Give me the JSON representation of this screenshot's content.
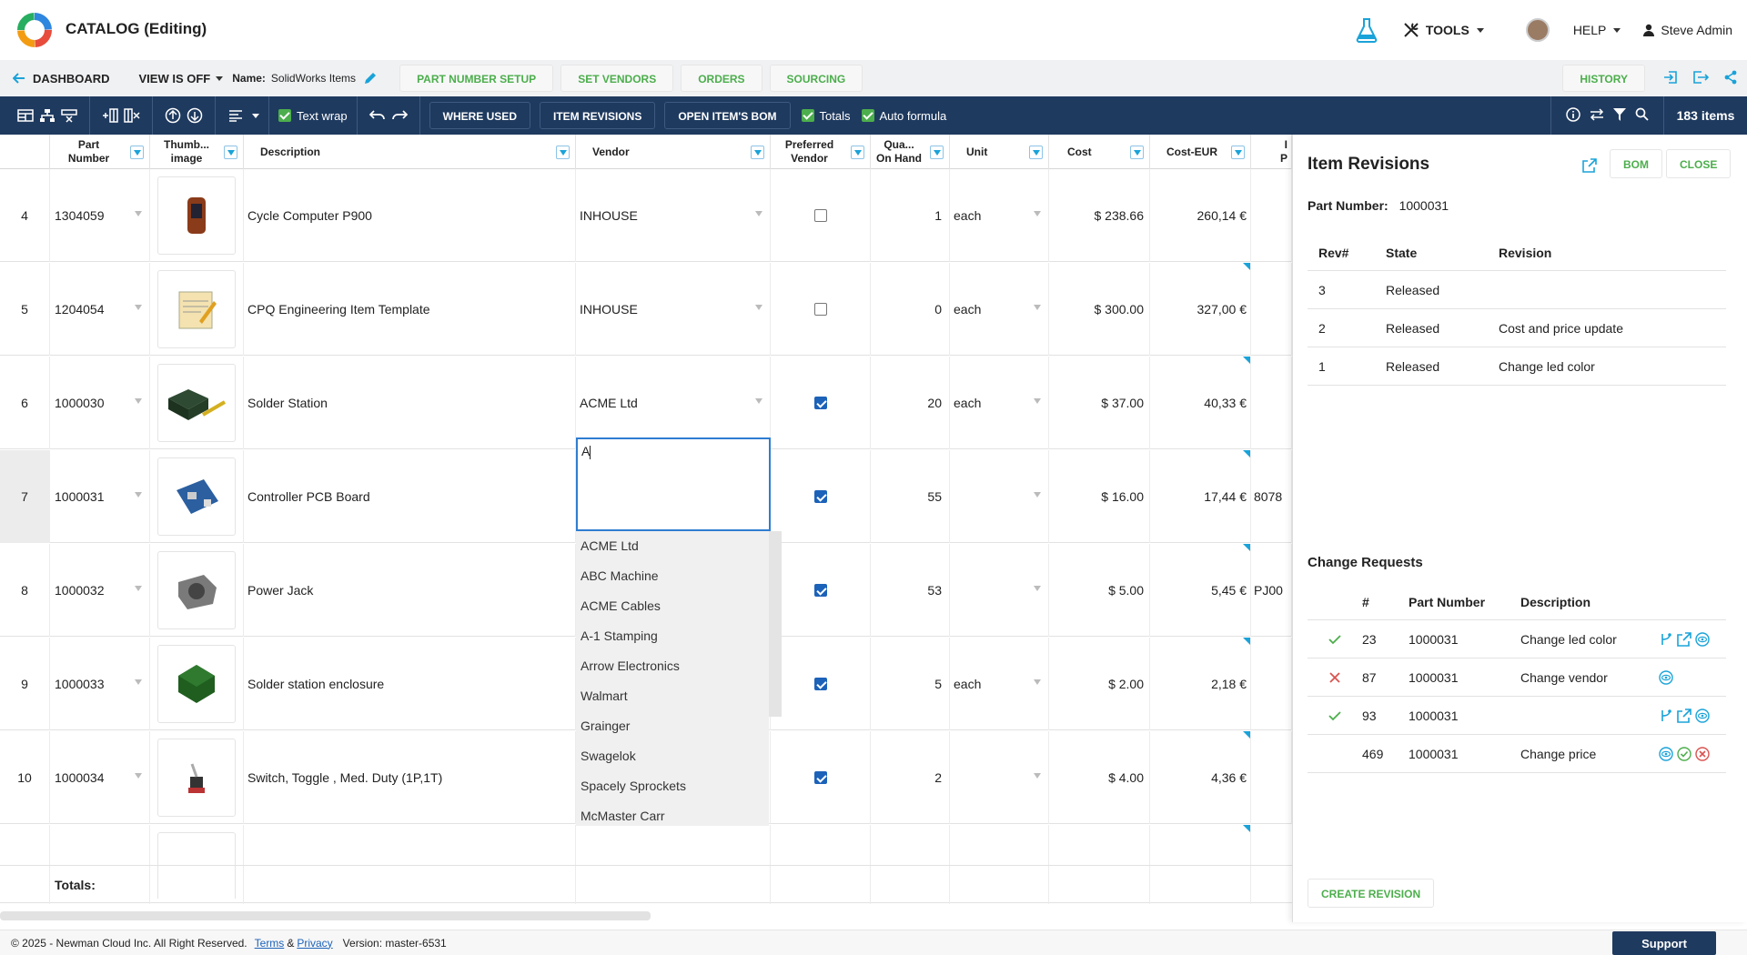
{
  "header": {
    "app_title": "CATALOG (Editing)",
    "tools_label": "TOOLS",
    "help_label": "HELP",
    "user_name": "Steve Admin"
  },
  "subnav": {
    "back_label": "DASHBOARD",
    "view_label": "VIEW IS OFF",
    "name_label": "Name:",
    "name_value": "SolidWorks Items",
    "tabs": [
      "PART NUMBER SETUP",
      "SET VENDORS",
      "ORDERS",
      "SOURCING"
    ],
    "history_label": "HISTORY"
  },
  "toolbar": {
    "text_wrap_label": "Text wrap",
    "text_wrap_checked": true,
    "where_used_label": "WHERE USED",
    "item_revisions_label": "ITEM REVISIONS",
    "open_bom_label": "OPEN ITEM'S BOM",
    "totals_label": "Totals",
    "totals_checked": true,
    "auto_formula_label": "Auto formula",
    "auto_formula_checked": true,
    "item_count": "183 items"
  },
  "grid": {
    "columns": [
      "Part\nNumber",
      "Thumb...\nimage",
      "Description",
      "Vendor",
      "Preferred\nVendor",
      "Qua...\nOn Hand",
      "Unit",
      "Cost",
      "Cost-EUR",
      "I\nP"
    ],
    "rows": [
      {
        "num": "4",
        "part": "1304059",
        "desc": "Cycle Computer P900",
        "vendor": "INHOUSE",
        "pref": false,
        "qty": "1",
        "unit": "each",
        "cost": "$ 238.66",
        "eur": "260,14 €",
        "extra": ""
      },
      {
        "num": "5",
        "part": "1204054",
        "desc": "CPQ Engineering Item Template",
        "vendor": "INHOUSE",
        "pref": false,
        "qty": "0",
        "unit": "each",
        "cost": "$ 300.00",
        "eur": "327,00 €",
        "extra": ""
      },
      {
        "num": "6",
        "part": "1000030",
        "desc": "Solder Station",
        "vendor": "ACME Ltd",
        "pref": true,
        "qty": "20",
        "unit": "each",
        "cost": "$ 37.00",
        "eur": "40,33 €",
        "extra": ""
      },
      {
        "num": "7",
        "part": "1000031",
        "desc": "Controller PCB Board",
        "vendor": "",
        "pref": true,
        "qty": "55",
        "unit": "",
        "cost": "$ 16.00",
        "eur": "17,44 €",
        "extra": "8078"
      },
      {
        "num": "8",
        "part": "1000032",
        "desc": "Power Jack",
        "vendor": "",
        "pref": true,
        "qty": "53",
        "unit": "",
        "cost": "$ 5.00",
        "eur": "5,45 €",
        "extra": "PJ00"
      },
      {
        "num": "9",
        "part": "1000033",
        "desc": "Solder station enclosure",
        "vendor": "",
        "pref": true,
        "qty": "5",
        "unit": "each",
        "cost": "$ 2.00",
        "eur": "2,18 €",
        "extra": ""
      },
      {
        "num": "10",
        "part": "1000034",
        "desc": "Switch, Toggle , Med. Duty (1P,1T)",
        "vendor": "",
        "pref": true,
        "qty": "2",
        "unit": "",
        "cost": "$ 4.00",
        "eur": "4,36 €",
        "extra": ""
      }
    ],
    "vendor_input_value": "A",
    "vendor_options": [
      "ACME Ltd",
      "ABC Machine",
      "ACME Cables",
      "A-1 Stamping",
      "Arrow Electronics",
      "Walmart",
      "Grainger",
      "Swagelok",
      "Spacely Sprockets",
      "McMaster Carr"
    ],
    "totals_label": "Totals:"
  },
  "panel": {
    "title": "Item Revisions",
    "bom_label": "BOM",
    "close_label": "CLOSE",
    "part_number_label": "Part Number:",
    "part_number_value": "1000031",
    "rev_headers": [
      "Rev#",
      "State",
      "Revision"
    ],
    "revisions": [
      {
        "rev": "3",
        "state": "Released",
        "revision": ""
      },
      {
        "rev": "2",
        "state": "Released",
        "revision": "Cost and price update"
      },
      {
        "rev": "1",
        "state": "Released",
        "revision": "Change led color"
      }
    ],
    "cr_title": "Change Requests",
    "cr_headers": [
      "#",
      "Part Number",
      "Description"
    ],
    "change_requests": [
      {
        "status": "approved",
        "num": "23",
        "part": "1000031",
        "desc": "Change led color",
        "actions": [
          "branch-icon",
          "edit-icon",
          "view-icon"
        ]
      },
      {
        "status": "rejected",
        "num": "87",
        "part": "1000031",
        "desc": "Change vendor",
        "actions": [
          "view-icon"
        ]
      },
      {
        "status": "approved",
        "num": "93",
        "part": "1000031",
        "desc": "",
        "actions": [
          "branch-icon",
          "edit-icon",
          "view-icon"
        ]
      },
      {
        "status": "pending",
        "num": "469",
        "part": "1000031",
        "desc": "Change price",
        "actions": [
          "view-icon",
          "approve-icon",
          "reject-icon"
        ]
      }
    ],
    "create_revision_label": "CREATE REVISION"
  },
  "footer": {
    "copyright": "© 2025 - Newman Cloud Inc. All Right Reserved.",
    "terms_label": "Terms",
    "and_label": "&",
    "privacy_label": "Privacy",
    "version": "Version: master-6531",
    "support_label": "Support"
  },
  "colors": {
    "navy": "#1f3a5f",
    "green": "#4cae4c",
    "blue": "#1aa3d9",
    "checkbox_blue": "#1c62b9",
    "reject_red": "#d9534f"
  }
}
